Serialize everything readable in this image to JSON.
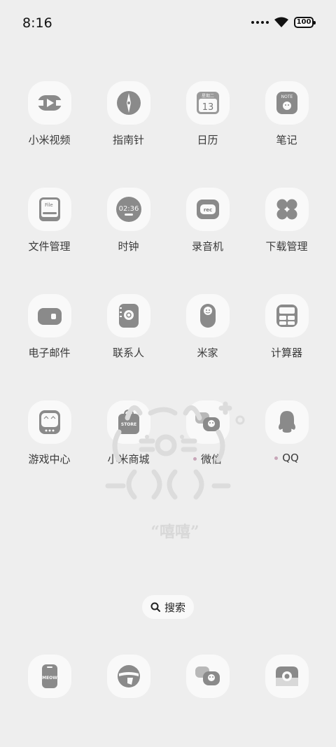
{
  "status_bar": {
    "time": "8:16",
    "battery": "100"
  },
  "apps": [
    {
      "label": "小米视频",
      "icon": "video-icon"
    },
    {
      "label": "指南针",
      "icon": "compass-icon"
    },
    {
      "label": "日历",
      "icon": "calendar-icon",
      "badge_text": "13",
      "sub_text": "星期二"
    },
    {
      "label": "笔记",
      "icon": "notes-icon",
      "sub_text": "NOTE"
    },
    {
      "label": "文件管理",
      "icon": "file-icon",
      "sub_text": "File"
    },
    {
      "label": "时钟",
      "icon": "clock-icon",
      "sub_text": "02:36"
    },
    {
      "label": "录音机",
      "icon": "recorder-icon",
      "sub_text": "rec"
    },
    {
      "label": "下载管理",
      "icon": "download-icon"
    },
    {
      "label": "电子邮件",
      "icon": "mail-icon"
    },
    {
      "label": "联系人",
      "icon": "contacts-icon"
    },
    {
      "label": "米家",
      "icon": "mijia-icon"
    },
    {
      "label": "计算器",
      "icon": "calculator-icon"
    },
    {
      "label": "游戏中心",
      "icon": "game-icon"
    },
    {
      "label": "小米商城",
      "icon": "store-icon",
      "sub_text": "STORE"
    },
    {
      "label": "微信",
      "icon": "wechat-icon",
      "new_dot": true
    },
    {
      "label": "QQ",
      "icon": "qq-icon",
      "new_dot": true
    }
  ],
  "wallpaper": {
    "caption": "“嘻嘻”"
  },
  "search": {
    "label": "搜索"
  },
  "dock": [
    {
      "icon": "phone-icon",
      "sub_text": "MEOW"
    },
    {
      "icon": "browser-icon"
    },
    {
      "icon": "messages-icon"
    },
    {
      "icon": "camera-icon"
    }
  ]
}
